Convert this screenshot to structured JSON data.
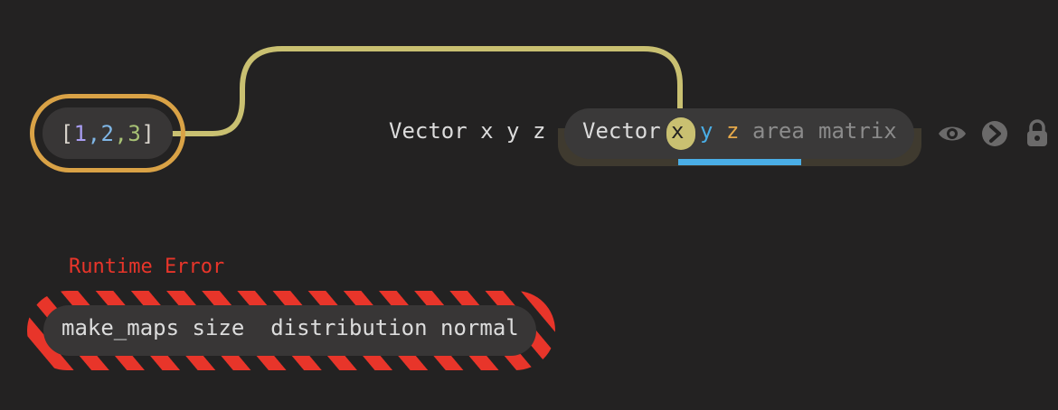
{
  "literal_node": {
    "open": "[",
    "n1": "1",
    "c1": ",",
    "n2": "2",
    "c2": ",",
    "n3": "3",
    "close": "]"
  },
  "vector_label": "Vector x y z",
  "vector_node": {
    "name": "Vector",
    "ports": {
      "x": "x",
      "y": "y",
      "z": "z",
      "area": "area",
      "matrix": "matrix"
    }
  },
  "toolbar_icons": [
    "eye-icon",
    "chevron-right-icon",
    "lock-icon"
  ],
  "error": {
    "label": "Runtime Error",
    "expression": "make_maps size  distribution normal"
  },
  "colors": {
    "background": "#232222",
    "node": "#383636",
    "literal_ring": "#d9a246",
    "wire": "#c9c071",
    "port_active": "#4aaee6",
    "error": "#e8352a"
  }
}
